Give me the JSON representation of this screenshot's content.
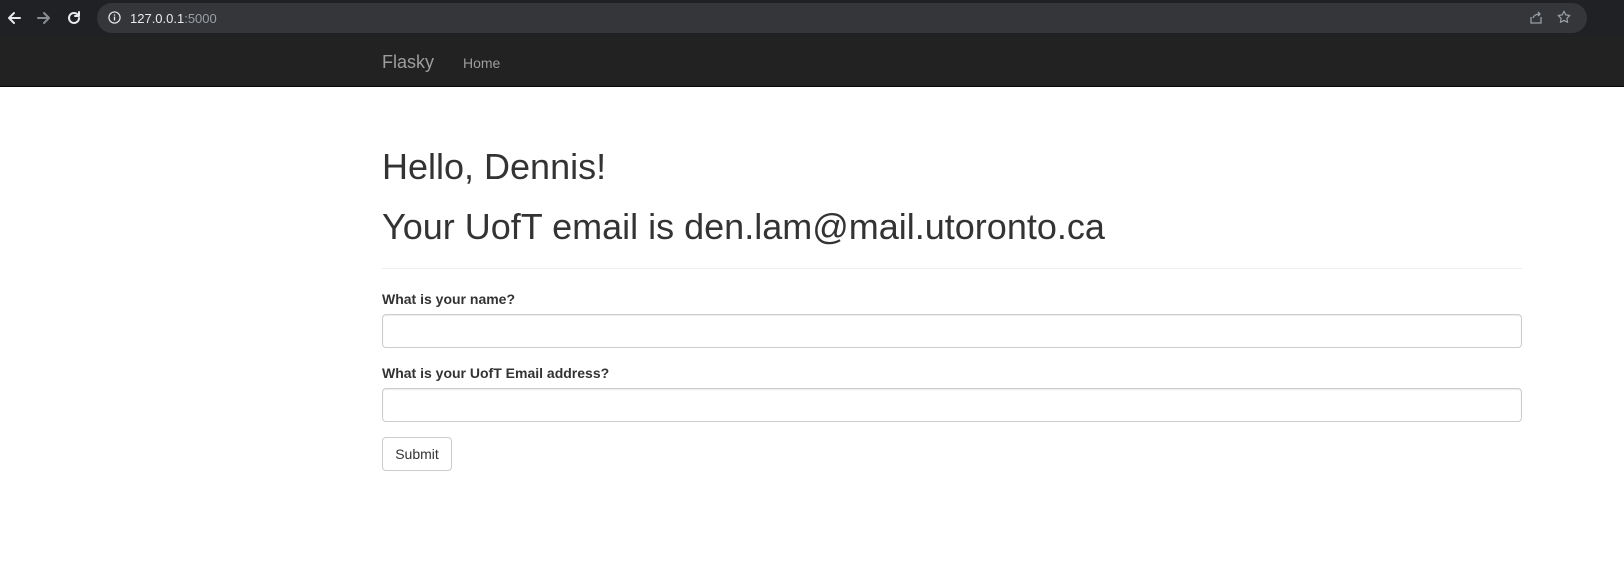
{
  "browser": {
    "url_host": "127.0.0.1",
    "url_port": ":5000"
  },
  "navbar": {
    "brand": "Flasky",
    "home_label": "Home"
  },
  "header": {
    "greeting": "Hello, Dennis!",
    "email_line": "Your UofT email is den.lam@mail.utoronto.ca"
  },
  "form": {
    "name_label": "What is your name?",
    "name_value": "",
    "email_label": "What is your UofT Email address?",
    "email_value": "",
    "submit_label": "Submit"
  },
  "icons": {
    "back": "arrow-left-icon",
    "forward": "arrow-right-icon",
    "reload": "reload-icon",
    "site_info": "info-icon",
    "share": "share-icon",
    "bookmark": "star-icon"
  },
  "colors": {
    "browser_bar": "#202124",
    "omnibox": "#35363a",
    "navbar": "#222222",
    "navbar_text": "#9d9d9d",
    "heading_text": "#333333"
  }
}
